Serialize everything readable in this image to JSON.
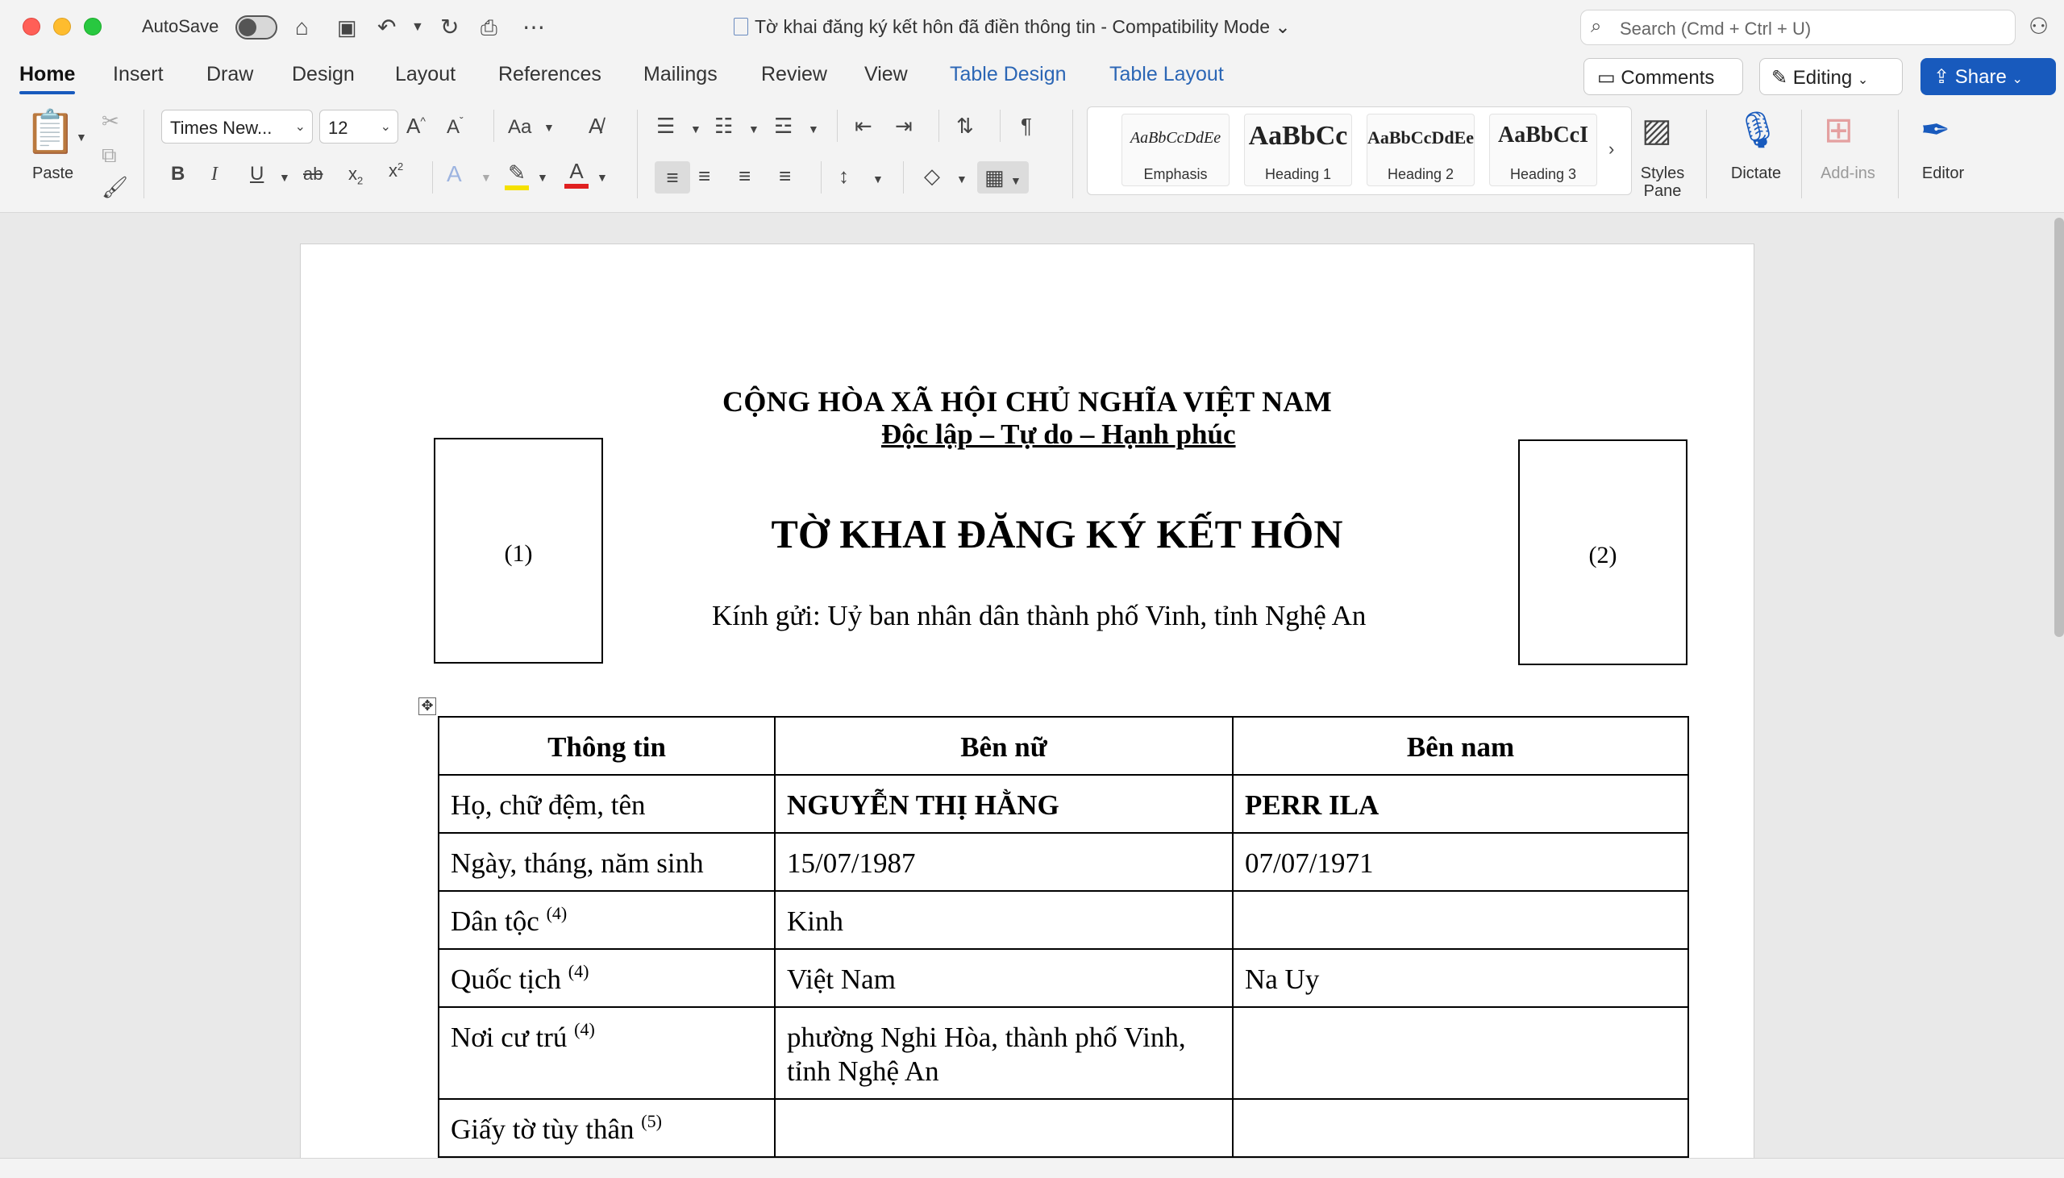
{
  "window": {
    "autosave_label": "AutoSave",
    "doc_title": "Tờ khai đăng ký kết hôn đã điền thông tin  -  Compatibility Mode ⌄",
    "search_placeholder": "Search (Cmd + Ctrl + U)"
  },
  "tabs": [
    {
      "label": "Home"
    },
    {
      "label": "Insert"
    },
    {
      "label": "Draw"
    },
    {
      "label": "Design"
    },
    {
      "label": "Layout"
    },
    {
      "label": "References"
    },
    {
      "label": "Mailings"
    },
    {
      "label": "Review"
    },
    {
      "label": "View"
    },
    {
      "label": "Table Design"
    },
    {
      "label": "Table Layout"
    }
  ],
  "actions": {
    "comments": "Comments",
    "editing": "Editing",
    "share": "Share"
  },
  "ribbon": {
    "paste": "Paste",
    "font_name": "Times New...",
    "font_size": "12",
    "change_case": "Aa",
    "styles": [
      {
        "preview": "AaBbCcDdEe",
        "name": "Emphasis"
      },
      {
        "preview": "AaBbCc",
        "name": "Heading 1"
      },
      {
        "preview": "AaBbCcDdEe",
        "name": "Heading 2"
      },
      {
        "preview": "AaBbCcI",
        "name": "Heading 3"
      }
    ],
    "styles_pane": "Styles Pane",
    "dictate": "Dictate",
    "addins": "Add-ins",
    "editor": "Editor"
  },
  "document": {
    "national_title": "CỘNG HÒA XÃ HỘI CHỦ NGHĨA VIỆT NAM",
    "motto": "Độc lập – Tự do – Hạnh phúc",
    "photo_left": "(1)",
    "photo_right": "(2)",
    "form_title": "TỜ KHAI ĐĂNG KÝ KẾT HÔN",
    "addressee": "Kính gửi: Uỷ ban nhân dân thành phố Vinh, tỉnh Nghệ An",
    "table": {
      "headers": [
        "Thông tin",
        "Bên nữ",
        "Bên nam"
      ],
      "rows": [
        {
          "label": "Họ, chữ đệm, tên",
          "sup": "",
          "female": "NGUYỄN THỊ HẰNG",
          "male": "PERR ILA"
        },
        {
          "label": "Ngày, tháng, năm sinh",
          "sup": "",
          "female": "15/07/1987",
          "male": "07/07/1971"
        },
        {
          "label": "Dân tộc",
          "sup": "(4)",
          "female": "Kinh",
          "male": ""
        },
        {
          "label": "Quốc tịch",
          "sup": "(4)",
          "female": "Việt Nam",
          "male": "Na Uy"
        },
        {
          "label": "Nơi cư trú",
          "sup": "(4)",
          "female": "phường Nghi Hòa, thành phố Vinh, tỉnh Nghệ An",
          "male": ""
        },
        {
          "label": "Giấy tờ tùy thân",
          "sup": "(5)",
          "female": "",
          "male": ""
        }
      ]
    }
  }
}
